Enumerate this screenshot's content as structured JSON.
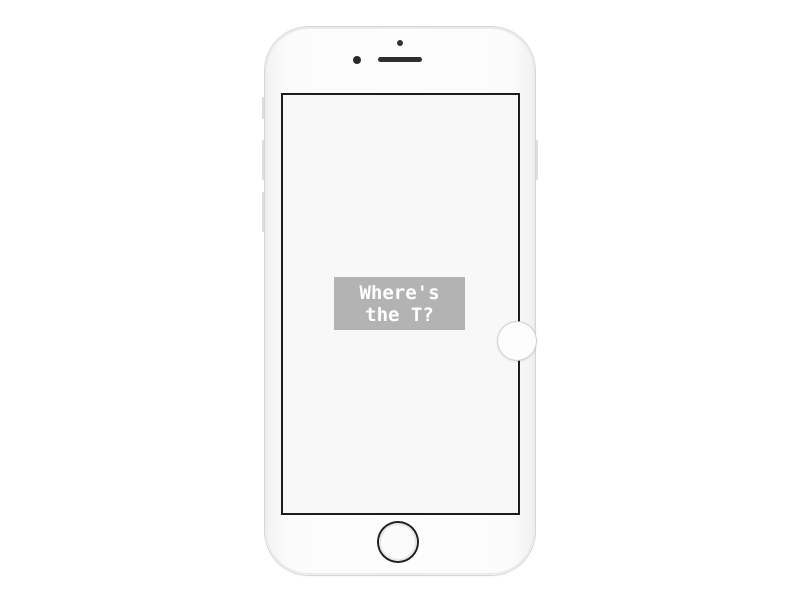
{
  "screen": {
    "label_text": "Where's\nthe T?"
  },
  "colors": {
    "screen_background": "#f8f8f8",
    "label_background": "#b3b3b3",
    "label_text": "#ffffff",
    "phone_body": "#fbfbfb"
  },
  "icons": {
    "home_button": "home-button-icon",
    "assistive_touch": "assistive-touch-icon",
    "camera": "front-camera-icon",
    "speaker": "earpiece-speaker-icon"
  }
}
